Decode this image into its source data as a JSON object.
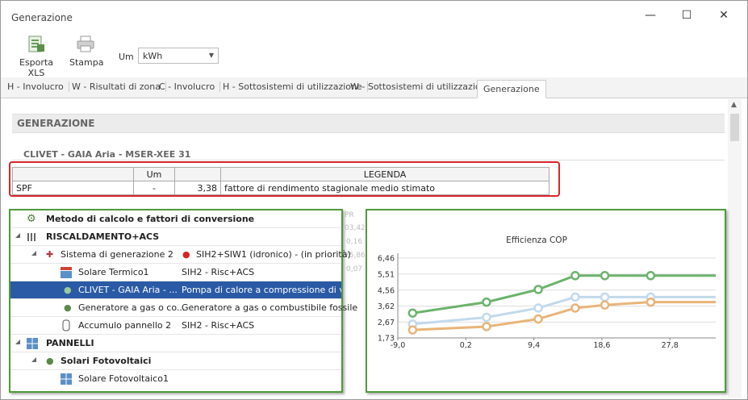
{
  "window": {
    "title": "Generazione",
    "minimize": "—",
    "maximize": "☐",
    "close": "✕"
  },
  "toolbar": {
    "export_label": "Esporta XLS",
    "print_label": "Stampa",
    "um_label": "Um",
    "um_value": "kWh"
  },
  "tabs": [
    "H - Involucro",
    "W - Risultati di zona",
    "C - Involucro",
    "H - Sottosistemi di utilizzazione",
    "W - Sottosistemi di utilizzazione",
    "Generazione"
  ],
  "section_title": "GENERAZIONE",
  "unit_title": "CLIVET - GAIA Aria - MSER-XEE 31",
  "spf_table": {
    "headers": [
      "",
      "Um",
      "",
      "LEGENDA"
    ],
    "row": [
      "SPF",
      "-",
      "3,38",
      "fattore di rendimento stagionale medio stimato"
    ]
  },
  "tree": {
    "rows": [
      {
        "label": "Metodo di calcolo e fattori di conversione",
        "value": ""
      },
      {
        "label": "RISCALDAMENTO+ACS",
        "value": ""
      },
      {
        "label": "Sistema di generazione 2",
        "value": "SIH2+SIW1 (idronico) - (in priorità)"
      },
      {
        "label": "Solare Termico1",
        "value": "SIH2 - Risc+ACS"
      },
      {
        "label": "CLIVET - GAIA Aria - ...",
        "value": "Pompa di calore a compressione di va..."
      },
      {
        "label": "Generatore a gas o co...",
        "value": "Generatore a gas o combustibile fossile"
      },
      {
        "label": "Accumulo pannello 2",
        "value": "SIH2 - Risc+ACS"
      },
      {
        "label": "PANNELLI",
        "value": ""
      },
      {
        "label": "Solari Fotovoltaici",
        "value": ""
      },
      {
        "label": "Solare Fotovoltaico1",
        "value": ""
      }
    ]
  },
  "ghost_values": [
    "PR",
    "03,42",
    "0,16",
    "75,86",
    "0,07"
  ],
  "chart_data": {
    "type": "line",
    "title": "Efficienza COP",
    "xlim": [
      -9.0,
      34.0
    ],
    "ylim": [
      1.73,
      6.46
    ],
    "x_ticks": [
      "-9,0",
      "0,2",
      "9,4",
      "18,6",
      "27,8"
    ],
    "y_ticks": [
      "6,46",
      "5,51",
      "4,56",
      "3,62",
      "2,67",
      "1,73"
    ],
    "series": [
      {
        "color": "#6cb36c",
        "x": [
          -7,
          3,
          10,
          15,
          19,
          25.2,
          34
        ],
        "y": [
          3.2,
          3.85,
          4.6,
          5.42,
          5.42,
          5.42,
          5.42
        ]
      },
      {
        "color": "#c2d9ec",
        "x": [
          -7,
          3,
          10,
          15,
          19,
          25.2,
          34
        ],
        "y": [
          2.55,
          2.95,
          3.5,
          4.15,
          4.15,
          4.15,
          4.15
        ]
      },
      {
        "color": "#e8b478",
        "x": [
          -7,
          3,
          10,
          15,
          19,
          25.2,
          34
        ],
        "y": [
          2.2,
          2.4,
          2.85,
          3.5,
          3.68,
          3.85,
          3.85
        ]
      }
    ],
    "marker_count": 6
  }
}
